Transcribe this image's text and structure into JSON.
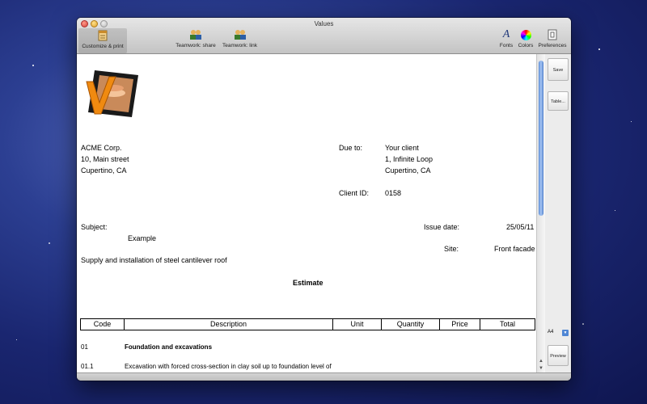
{
  "window": {
    "title": "Values"
  },
  "toolbar": {
    "customize": "Customize & print",
    "teamwork_share": "Teamwork: share",
    "teamwork_link": "Teamwork: link",
    "fonts": "Fonts",
    "colors": "Colors",
    "preferences": "Preferences"
  },
  "sidebar": {
    "save_as": "Save as...",
    "table": "Table...",
    "page_size": "A4",
    "preview": "Preview"
  },
  "document": {
    "company": [
      "ACME Corp.",
      "10, Main street",
      "Cupertino, CA"
    ],
    "due_to_label": "Due to:",
    "client": [
      "Your client",
      "1, Infinite Loop",
      "Cupertino, CA"
    ],
    "client_id_label": "Client ID:",
    "client_id": "0158",
    "subject_label": "Subject:",
    "subject": "Example",
    "issue_date_label": "Issue date:",
    "issue_date": "25/05/11",
    "site_label": "Site:",
    "site": "Front facade",
    "description": "Supply and installation of steel cantilever roof",
    "heading": "Estimate",
    "columns": [
      "Code",
      "Description",
      "Unit",
      "Quantity",
      "Price",
      "Total"
    ],
    "rows": [
      {
        "code": "01",
        "description": "Foundation and excavations"
      },
      {
        "code": "01.1",
        "description": "Excavation with forced cross-section in clay soil up to foundation level of"
      }
    ]
  },
  "colors": {
    "scroll_thumb": "#5d8dd6",
    "window_bg": "#e8e8e8"
  }
}
